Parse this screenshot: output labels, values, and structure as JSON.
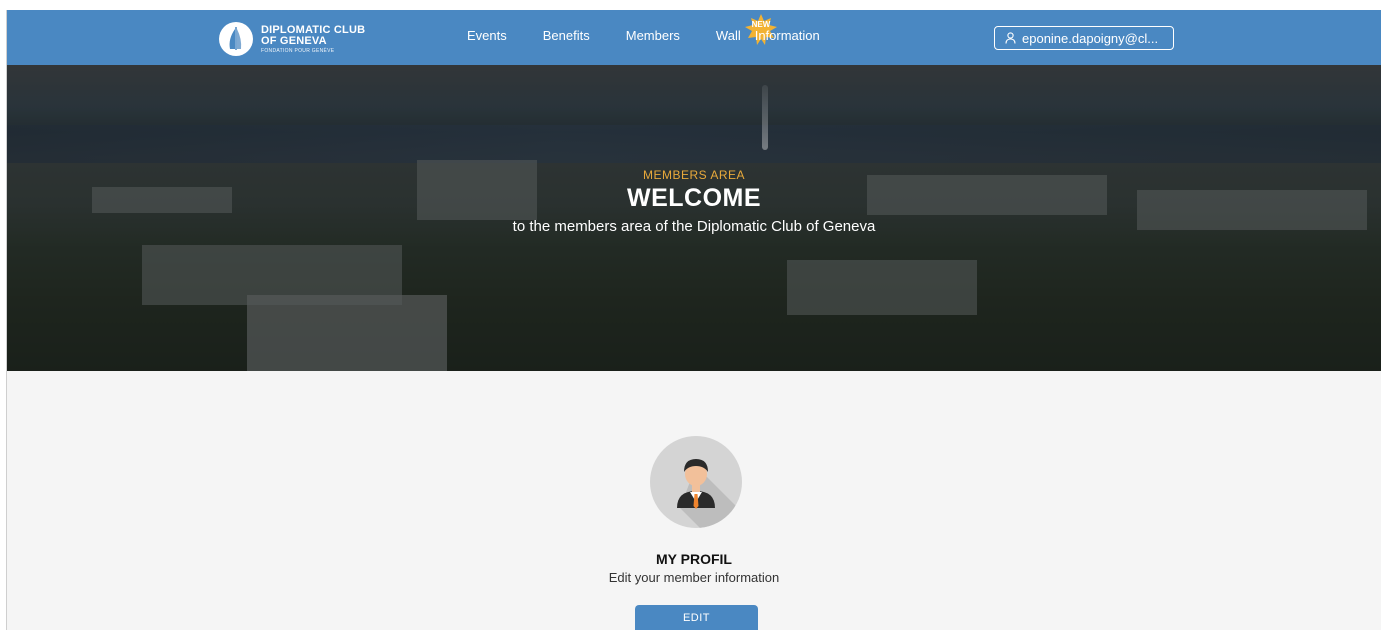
{
  "brand": {
    "line1": "DIPLOMATIC CLUB",
    "line2": "OF GENEVA",
    "line3": "FONDATION POUR GENÈVE"
  },
  "nav": {
    "items": [
      {
        "label": "Events"
      },
      {
        "label": "Benefits"
      },
      {
        "label": "Members"
      },
      {
        "label": "Wall",
        "badge": "NEW"
      },
      {
        "label": "Information"
      }
    ],
    "user": "eponine.dapoigny@cl..."
  },
  "hero": {
    "subtitle": "MEMBERS AREA",
    "title": "WELCOME",
    "description": "to the members area of the Diplomatic Club of Geneva"
  },
  "profile": {
    "title": "MY PROFIL",
    "description": "Edit your member information",
    "button": "EDIT"
  },
  "colors": {
    "nav_bg": "#4a88c2",
    "accent": "#e8a93b",
    "badge": "#f2b233",
    "page_bg": "#f5f5f5"
  }
}
